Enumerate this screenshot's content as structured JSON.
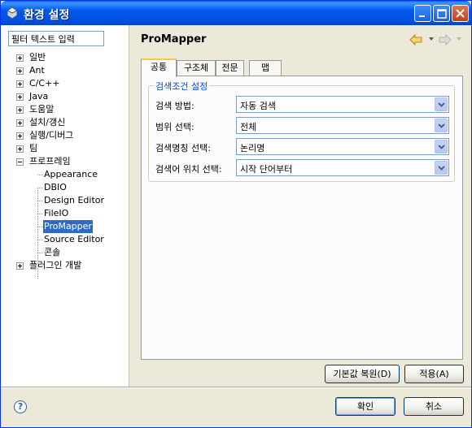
{
  "window": {
    "title": "환경 설정"
  },
  "filter": {
    "value": "필터 텍스트 입력"
  },
  "tree": [
    {
      "label": "일반",
      "expand": "plus"
    },
    {
      "label": "Ant",
      "expand": "plus"
    },
    {
      "label": "C/C++",
      "expand": "plus"
    },
    {
      "label": "Java",
      "expand": "plus"
    },
    {
      "label": "도움말",
      "expand": "plus"
    },
    {
      "label": "설치/갱신",
      "expand": "plus"
    },
    {
      "label": "실행/디버그",
      "expand": "plus"
    },
    {
      "label": "팀",
      "expand": "plus"
    },
    {
      "label": "프로프레임",
      "expand": "minus"
    },
    {
      "label": "Appearance",
      "child": true
    },
    {
      "label": "DBIO",
      "child": true
    },
    {
      "label": "Design Editor",
      "child": true
    },
    {
      "label": "FileIO",
      "child": true
    },
    {
      "label": "ProMapper",
      "child": true,
      "selected": true
    },
    {
      "label": "Source Editor",
      "child": true
    },
    {
      "label": "콘솔",
      "child": true
    },
    {
      "label": "플러그인 개발",
      "expand": "plus"
    }
  ],
  "page": {
    "title": "ProMapper"
  },
  "tabs": [
    {
      "label": "공통",
      "active": true
    },
    {
      "label": "구조체"
    },
    {
      "label": "전문"
    },
    {
      "label": "맵"
    }
  ],
  "group": {
    "legend": "검색조건 설정",
    "rows": [
      {
        "label": "검색 방법:",
        "value": "자동 검색"
      },
      {
        "label": "범위 선택:",
        "value": "전체"
      },
      {
        "label": "검색명칭 선택:",
        "value": "논리명"
      },
      {
        "label": "검색어 위치 선택:",
        "value": "시작 단어부터"
      }
    ]
  },
  "buttons": {
    "restore_defaults": "기본값 복원(D)",
    "apply": "적용(A)",
    "ok": "확인",
    "cancel": "취소"
  },
  "colors": {
    "title_bar": "#0058ee",
    "selection": "#316ac5",
    "legend": "#0046d5",
    "tab_highlight": "#ffc83c"
  }
}
